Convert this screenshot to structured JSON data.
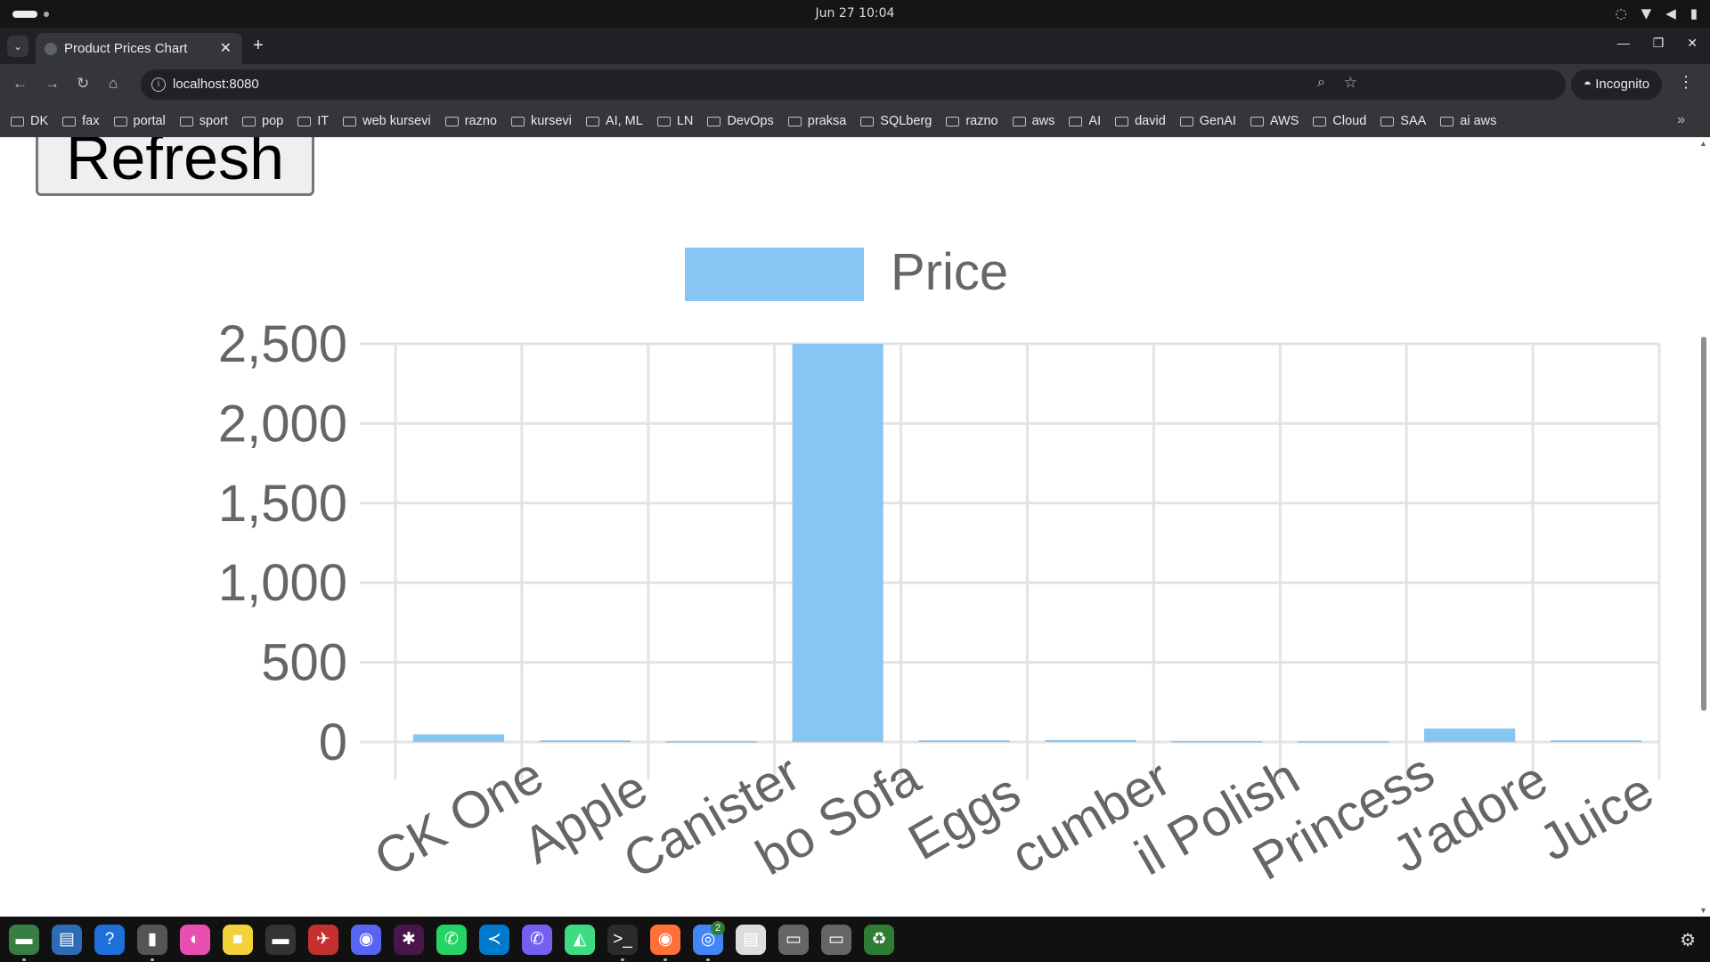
{
  "system": {
    "clock": "Jun 27  10:04"
  },
  "browser": {
    "tab_title": "Product Prices Chart",
    "close_glyph": "✕",
    "new_tab_glyph": "+",
    "url": "localhost:8080",
    "incognito_label": "Incognito",
    "bookmarks": [
      "DK",
      "fax",
      "portal",
      "sport",
      "pop",
      "IT",
      "web kursevi",
      "razno",
      "kursevi",
      "AI, ML",
      "LN",
      "DevOps",
      "praksa",
      "SQLberg",
      "razno",
      "aws",
      "AI",
      "david",
      "GenAI",
      "AWS",
      "Cloud",
      "SAA",
      "ai aws"
    ],
    "more_bookmarks_glyph": "»"
  },
  "page": {
    "refresh_label": "Refresh"
  },
  "chart_data": {
    "type": "bar",
    "legend": [
      "Price"
    ],
    "series": [
      {
        "name": "Price",
        "color": "#87c5f2",
        "values": [
          48,
          10,
          5,
          2500,
          10,
          12,
          6,
          4,
          85,
          10
        ]
      }
    ],
    "categories": [
      "CK One",
      "Apple",
      "Canister",
      "bo Sofa",
      "Eggs",
      "cumber",
      "il Polish",
      "Princess",
      "J'adore",
      "Juice"
    ],
    "yticks": [
      "2,500",
      "2,000",
      "1,500",
      "1,000",
      "500",
      "0"
    ],
    "ylim": [
      0,
      2500
    ],
    "grid": true,
    "legend_position": "top"
  },
  "dock": {
    "apps": [
      "files-icon",
      "docs-icon",
      "help-icon",
      "notes-icon",
      "color-picker-icon",
      "sticky-notes-icon",
      "terminal-app-icon",
      "game-icon",
      "discord-icon",
      "slack-icon",
      "whatsapp-icon",
      "vscode-icon",
      "viber-icon",
      "android-studio-icon",
      "terminal-icon",
      "firefox-icon",
      "chrome-icon",
      "document-viewer-icon",
      "ssd-icon",
      "ssd-icon",
      "trash-icon"
    ],
    "chrome_badge": "2"
  }
}
